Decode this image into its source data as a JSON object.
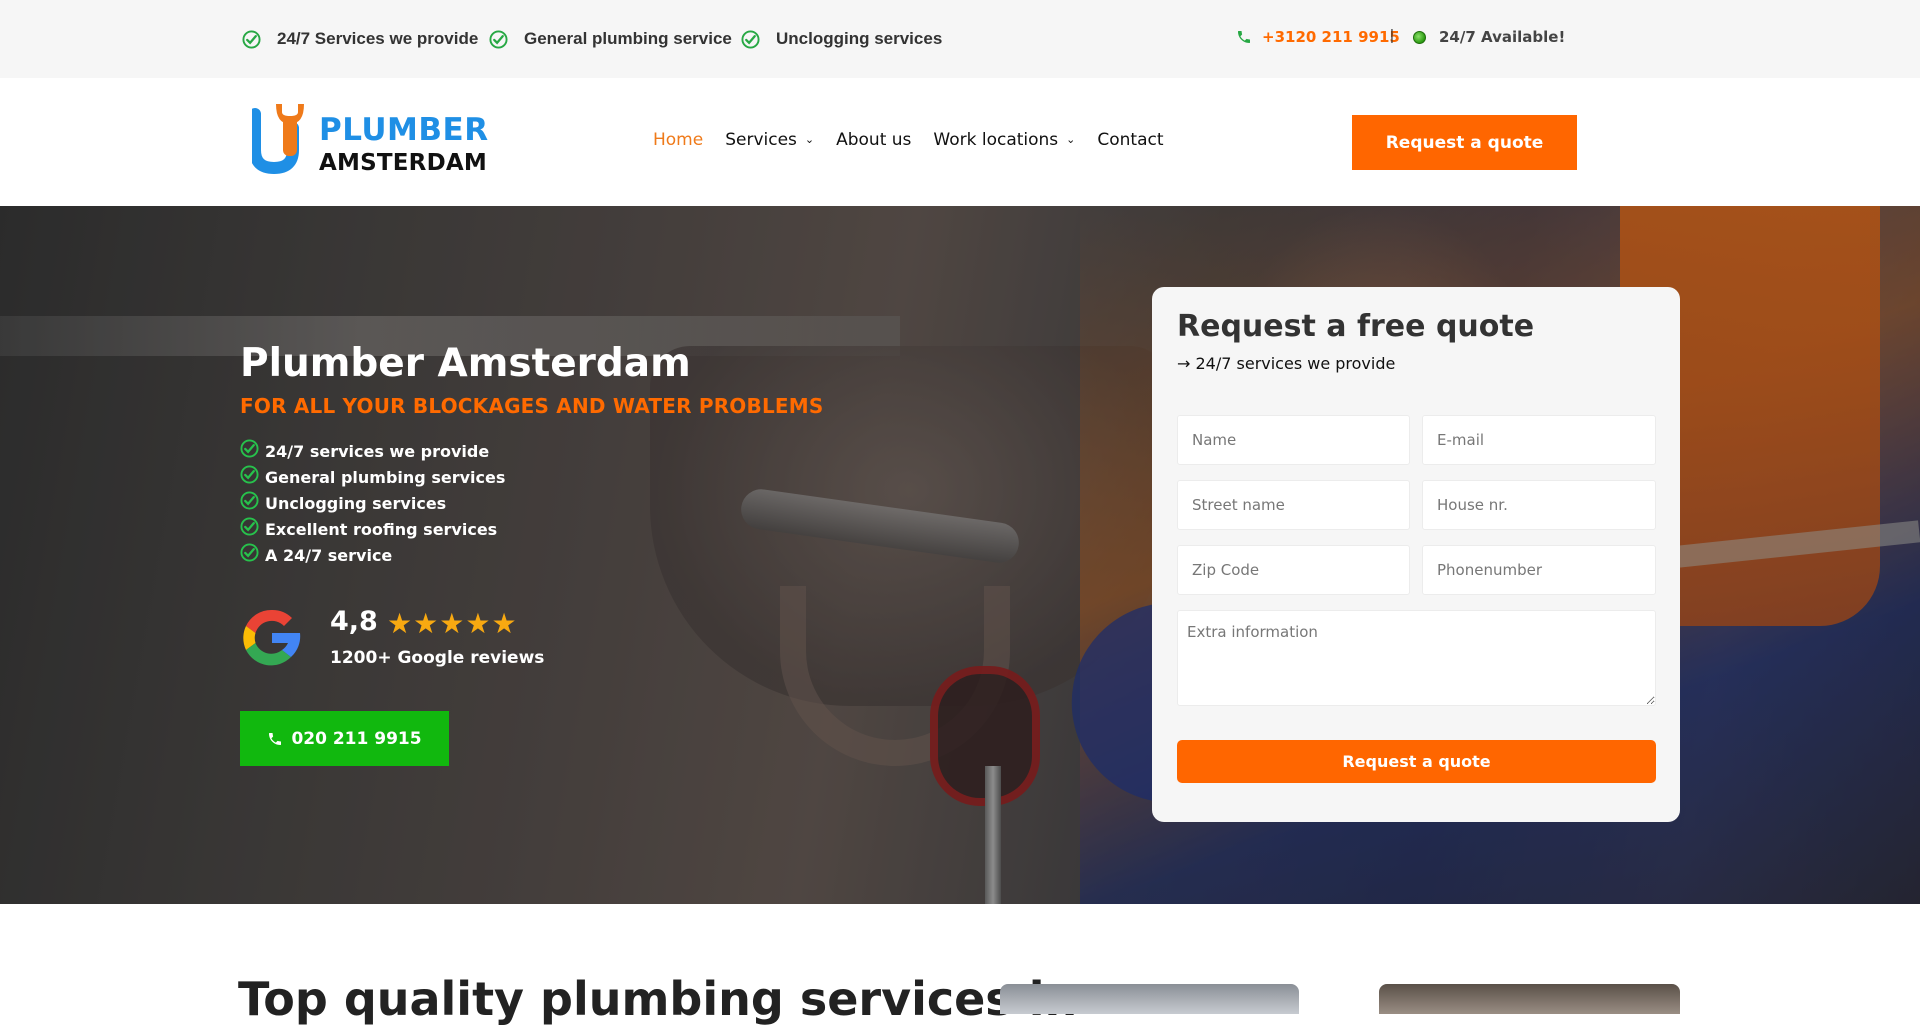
{
  "topbar": {
    "items": [
      "24/7 Services we provide",
      "General plumbing service",
      "Unclogging services"
    ],
    "phone": "+3120 211 9915",
    "separator": "|",
    "availability": "24/7 Available!"
  },
  "logo": {
    "line1": "PLUMBER",
    "line2": "AMSTERDAM"
  },
  "nav": {
    "items": [
      {
        "label": "Home",
        "active": true
      },
      {
        "label": "Services",
        "dropdown": true
      },
      {
        "label": "About us"
      },
      {
        "label": "Work locations",
        "dropdown": true
      },
      {
        "label": "Contact"
      }
    ],
    "quote_button": "Request a quote"
  },
  "hero": {
    "title": "Plumber Amsterdam",
    "subtitle": "FOR ALL YOUR BLOCKAGES AND WATER PROBLEMS",
    "features": [
      "24/7 services we provide",
      "General plumbing services",
      "Unclogging services",
      "Excellent roofing services",
      "A 24/7 service"
    ],
    "rating": {
      "score": "4,8",
      "stars": 5,
      "reviews": "1200+ Google reviews"
    },
    "call_button": "020 211 9915"
  },
  "form": {
    "title": "Request a free quote",
    "subtitle": "→ 24/7 services we provide",
    "placeholders": {
      "name": "Name",
      "email": "E-mail",
      "street": "Street name",
      "house": "House nr.",
      "zip": "Zip Code",
      "phone": "Phonenumber",
      "extra": "Extra information"
    },
    "submit": "Request a quote"
  },
  "section": {
    "title": "Top quality plumbing services in"
  },
  "colors": {
    "accent": "#ff6600",
    "green": "#11b80e",
    "blue": "#1f8fe5",
    "star": "#f8a911"
  }
}
